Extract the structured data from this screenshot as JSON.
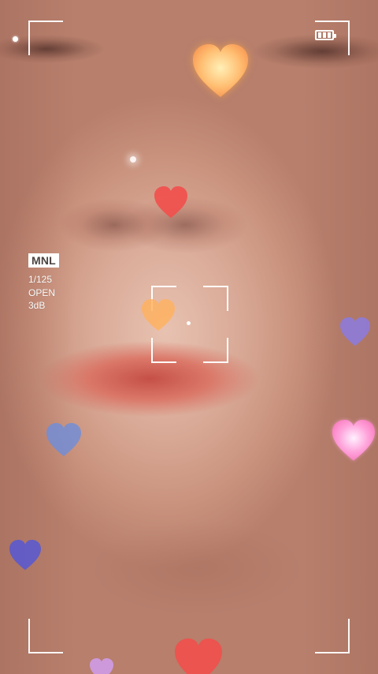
{
  "camera_overlay": {
    "mode": "MNL",
    "shutter_speed": "1/125",
    "aperture": "OPEN",
    "gain": "3dB",
    "battery_level": 1.0
  },
  "colors": {
    "overlay": "#ffffff",
    "rec_indicator": "#ff3a3a",
    "heart_orange": "#ffb15e",
    "heart_red": "#f1504d",
    "heart_blue": "#6f8ed9",
    "heart_purple": "#8c7be0",
    "heart_pink": "#ff96cf"
  },
  "icons": {
    "battery": "battery-full-icon",
    "rec": "record-indicator-icon",
    "focus": "focus-frame-icon",
    "decorations": "heart-icon"
  }
}
